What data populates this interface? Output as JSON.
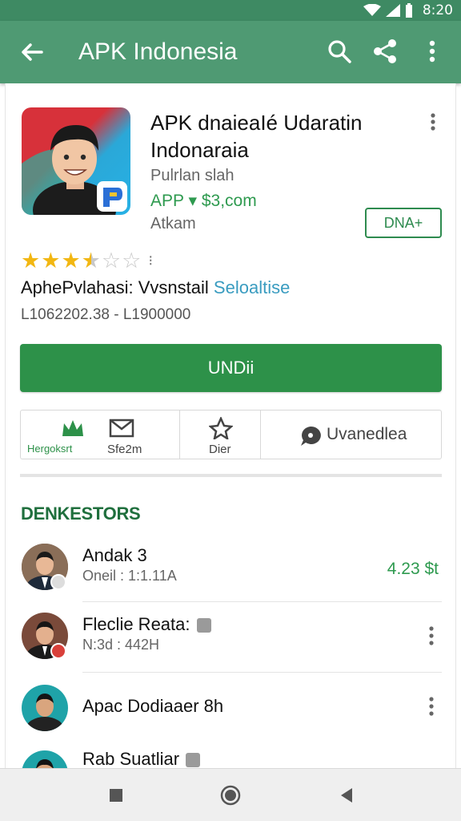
{
  "status_bar": {
    "time": "8:20"
  },
  "app_bar": {
    "title": "APK Indonesia"
  },
  "app": {
    "name": "APK dnaieaIé Udaratin Indonaraia",
    "publisher": "Pulrlan slah",
    "price": "APP ▾ $3,com",
    "category": "Atkam",
    "badge_button": "DNA+",
    "rating": 3.5,
    "rating_marker": "⁝",
    "info_prefix": "AphePvlahasi: Vvsnstail",
    "info_accent": "Seloaltise",
    "stats": "L1062202.38  -  L1900000",
    "install_label": "UNDii",
    "accent_color": "#2d9149",
    "header_color": "#4f9a73"
  },
  "actions": [
    {
      "label_a": "Hergoksrt",
      "label_b": "Sfe2m",
      "icon": "crown-icon"
    },
    {
      "label": "Dier",
      "icon": "star-icon"
    },
    {
      "label": "Uvanedlea",
      "icon": "comment-icon"
    }
  ],
  "section": {
    "title": "DENKESTORS"
  },
  "list": [
    {
      "title": "Andak 3",
      "subtitle": "Oneil : 1:1.11A",
      "price": "4.23 $t",
      "badge": "check"
    },
    {
      "title": "Fleclie Reata:",
      "subtitle": "N:3d : 442H",
      "badge": "red"
    },
    {
      "title": "Apac Dodiaaer 8h",
      "subtitle": ""
    },
    {
      "title": "Rab Suatliar",
      "subtitle": ""
    }
  ]
}
